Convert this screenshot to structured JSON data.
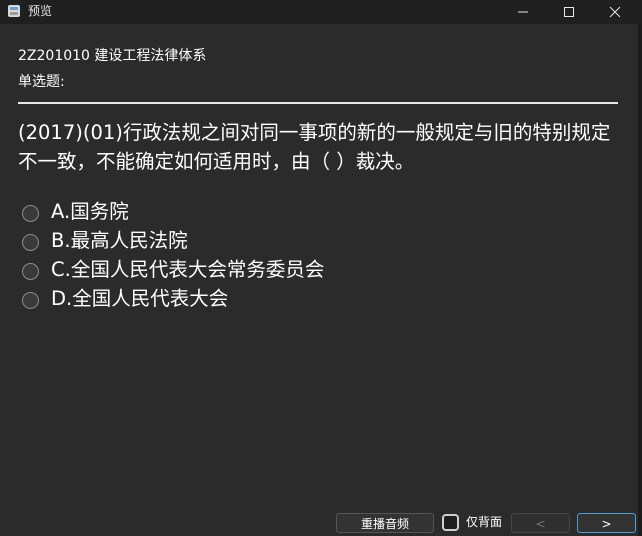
{
  "window": {
    "title": "预览",
    "app_icon": "app-icon",
    "controls": {
      "minimize_icon": "minimize-icon",
      "maximize_icon": "maximize-icon",
      "close_icon": "close-icon"
    }
  },
  "header": {
    "title": "2Z201010 建设工程法律体系",
    "question_type": "单选题:"
  },
  "question": {
    "text": "(2017)(01)行政法规之间对同一事项的新的一般规定与旧的特别规定不一致，不能确定如何适用时，由（ ）裁决。",
    "options": [
      {
        "label": "A.国务院",
        "selected": false
      },
      {
        "label": "B.最高人民法院",
        "selected": false
      },
      {
        "label": "C.全国人民代表大会常务委员会",
        "selected": false
      },
      {
        "label": "D.全国人民代表大会",
        "selected": false
      }
    ]
  },
  "footer": {
    "replay_label": "重播音频",
    "back_only_label": "仅背面",
    "back_only_checked": false,
    "prev_label": "<",
    "next_label": ">"
  },
  "colors": {
    "background": "#2b2b2b",
    "titlebar": "#1f1f1f",
    "text": "#ffffff",
    "next_button_border": "#4a9fd8"
  }
}
